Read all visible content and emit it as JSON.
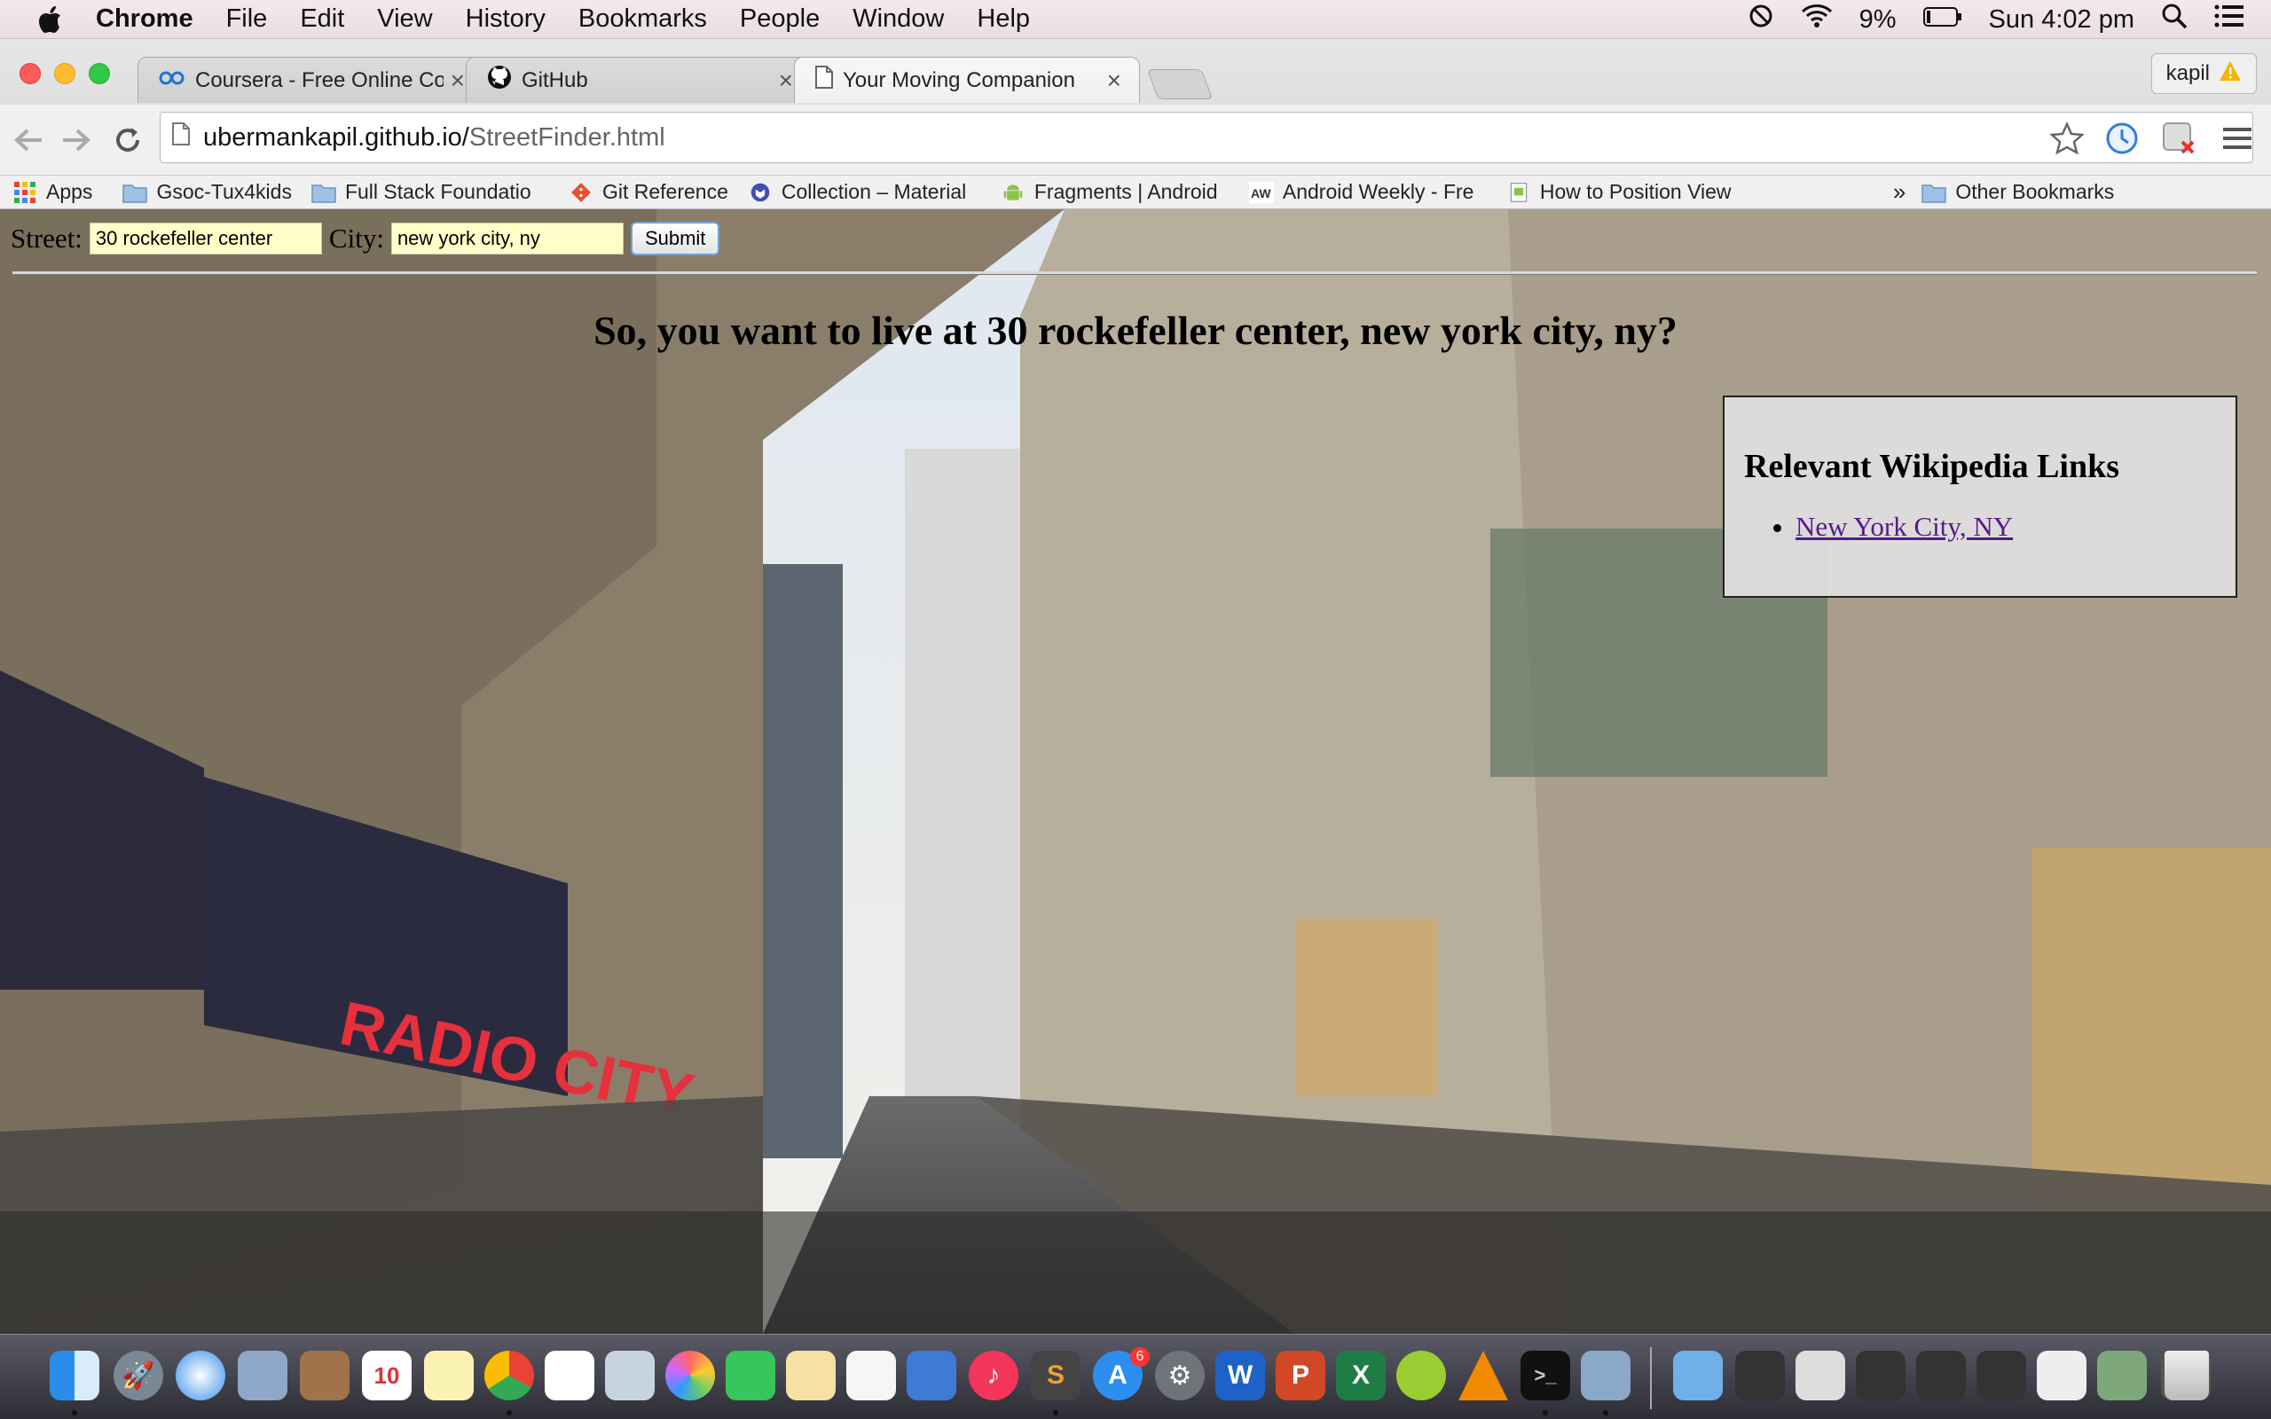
{
  "menubar": {
    "app_name": "Chrome",
    "items": [
      "File",
      "Edit",
      "View",
      "History",
      "Bookmarks",
      "People",
      "Window",
      "Help"
    ],
    "battery": "9%",
    "clock": "Sun 4:02 pm"
  },
  "browser": {
    "tabs": [
      {
        "title": "Coursera - Free Online Cou",
        "icon": "coursera-icon",
        "active": false
      },
      {
        "title": "GitHub",
        "icon": "github-icon",
        "active": false
      },
      {
        "title": "Your Moving Companion",
        "icon": "page-icon",
        "active": true
      }
    ],
    "profile_name": "kapil",
    "url_host": "ubermankapil.github.io/",
    "url_path": "StreetFinder.html",
    "bookmarks": [
      {
        "label": "Apps",
        "icon": "apps-grid-icon"
      },
      {
        "label": "Gsoc-Tux4kids",
        "icon": "folder-icon"
      },
      {
        "label": "Full Stack Foundatio",
        "icon": "folder-icon"
      },
      {
        "label": "Git Reference",
        "icon": "git-icon"
      },
      {
        "label": "Collection – Material",
        "icon": "material-icon"
      },
      {
        "label": "Fragments | Android",
        "icon": "android-icon"
      },
      {
        "label": "Android Weekly - Fre",
        "icon": "aw-icon"
      },
      {
        "label": "How to Position View",
        "icon": "page-icon"
      }
    ],
    "overflow_chevron": "»",
    "other_bookmarks": "Other Bookmarks"
  },
  "form": {
    "street_label": "Street:",
    "street_value": "30 rockefeller center",
    "city_label": "City:",
    "city_value": "new york city, ny",
    "submit_label": "Submit"
  },
  "greeting": "So, you want to live at 30 rockefeller center, new york city, ny?",
  "wiki": {
    "heading": "Relevant Wikipedia Links",
    "links": [
      "New York City, NY"
    ]
  },
  "dock": {
    "calendar_day": "10",
    "app_store_badge": "6"
  }
}
